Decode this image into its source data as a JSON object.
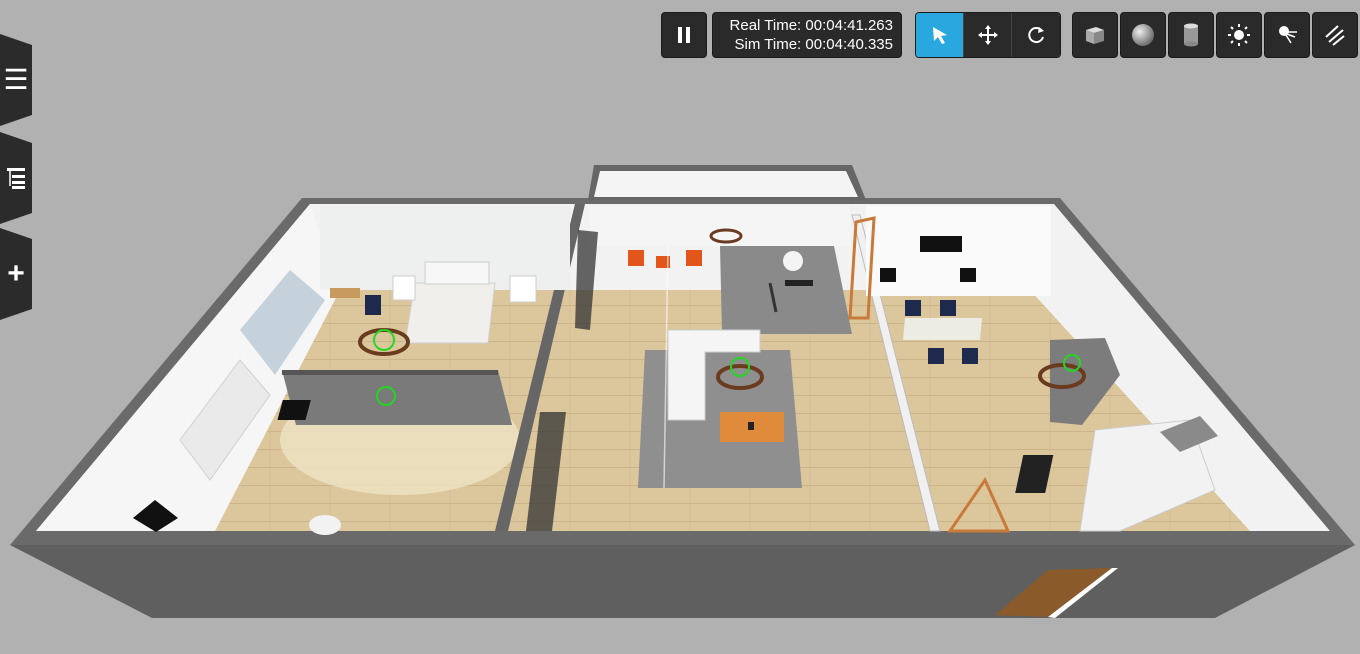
{
  "time": {
    "real_label": "Real Time:",
    "real_value": "00:04:41.263",
    "sim_label": "Sim Time:",
    "sim_value": "00:04:40.335"
  },
  "toolbar": {
    "play_state": "paused",
    "active_mode": "select",
    "modes": [
      "select-icon",
      "translate-icon",
      "rotate-icon"
    ],
    "shapes": [
      "box-icon",
      "sphere-icon",
      "cylinder-icon"
    ],
    "lights": [
      "point-light-icon",
      "spot-light-icon",
      "directional-light-icon"
    ],
    "accent": "#29a8e0"
  },
  "side_tabs": [
    "menu-icon",
    "tree-icon",
    "insert-icon"
  ],
  "scene": {
    "background": "#b1b1b1",
    "floor_color": "#d9c49a",
    "wall_color": "#666666",
    "rug_color": "#8c8c8c"
  }
}
